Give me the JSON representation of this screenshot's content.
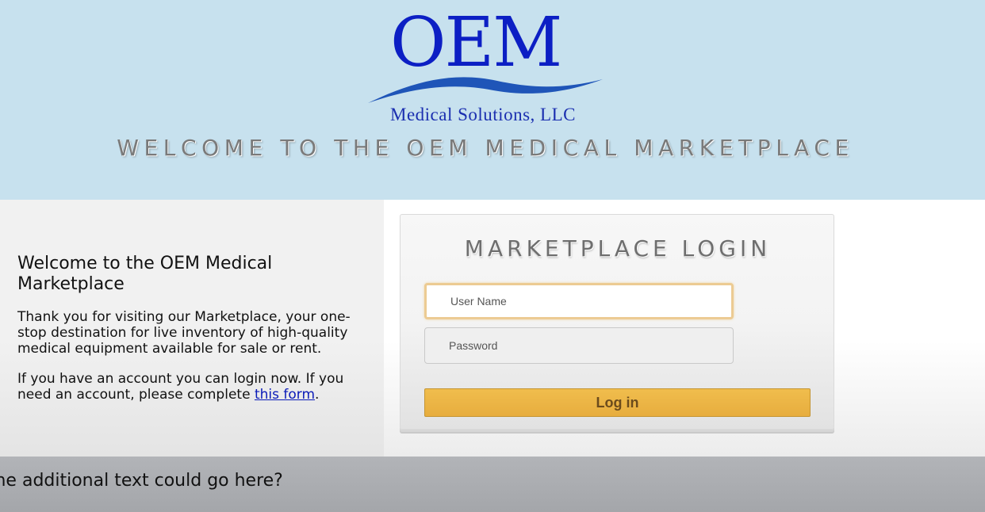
{
  "header": {
    "logo_main": "OEM",
    "logo_sub": "Medical Solutions, LLC",
    "welcome_title": "WELCOME TO THE OEM MEDICAL MARKETPLACE"
  },
  "intro": {
    "heading": "Welcome to the OEM Medical Marketplace",
    "paragraph1": "Thank you for visiting our Marketplace, your one-stop destination for live inventory of high-quality medical equipment available for sale or rent.",
    "paragraph2_before": "If you have an account you can login now. If you need an account, please complete ",
    "paragraph2_link": "this form",
    "paragraph2_after": "."
  },
  "login": {
    "title": "MARKETPLACE LOGIN",
    "username_placeholder": "User Name",
    "password_placeholder": "Password",
    "submit_label": "Log in"
  },
  "footer": {
    "text": "me additional text could go here?"
  },
  "colors": {
    "header_bg": "#c7e1ee",
    "logo_blue": "#0c1fc4",
    "button_gold": "#f0bd4d",
    "link_blue": "#0a1ab8"
  }
}
